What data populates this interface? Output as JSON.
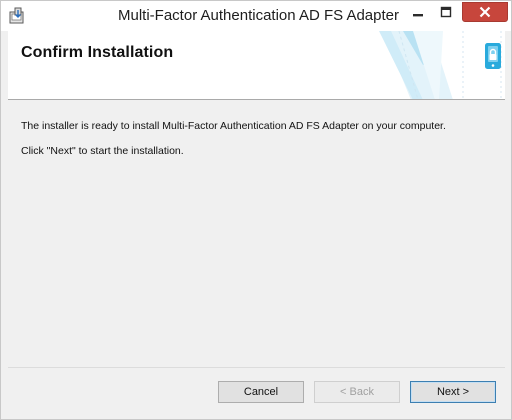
{
  "window": {
    "title": "Multi-Factor Authentication AD FS Adapter",
    "icon": "installer-icon",
    "controls": {
      "minimize": "minimize-icon",
      "maximize": "maximize-icon",
      "close": "close-icon"
    },
    "close_color": "#c7463c"
  },
  "header": {
    "title": "Confirm Installation",
    "accent_color": "#29aadc"
  },
  "body": {
    "line1": "The installer is ready to install Multi-Factor Authentication AD FS Adapter on your computer.",
    "line2": "Click \"Next\" to start the installation."
  },
  "buttons": {
    "cancel": "Cancel",
    "back": "< Back",
    "next": "Next >"
  }
}
